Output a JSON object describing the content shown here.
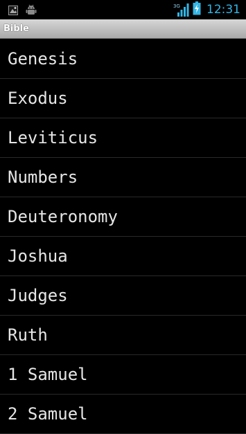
{
  "status_bar": {
    "network_type": "3G",
    "time": "12:31",
    "icons": [
      "notification-image-icon",
      "android-debug-icon",
      "signal-icon",
      "battery-charging-icon"
    ],
    "time_color": "#33b5e5"
  },
  "title_bar": {
    "title": "Bible"
  },
  "books": [
    {
      "label": "Genesis"
    },
    {
      "label": "Exodus"
    },
    {
      "label": "Leviticus"
    },
    {
      "label": "Numbers"
    },
    {
      "label": "Deuteronomy"
    },
    {
      "label": "Joshua"
    },
    {
      "label": "Judges"
    },
    {
      "label": "Ruth"
    },
    {
      "label": "1 Samuel"
    },
    {
      "label": "2 Samuel"
    }
  ]
}
